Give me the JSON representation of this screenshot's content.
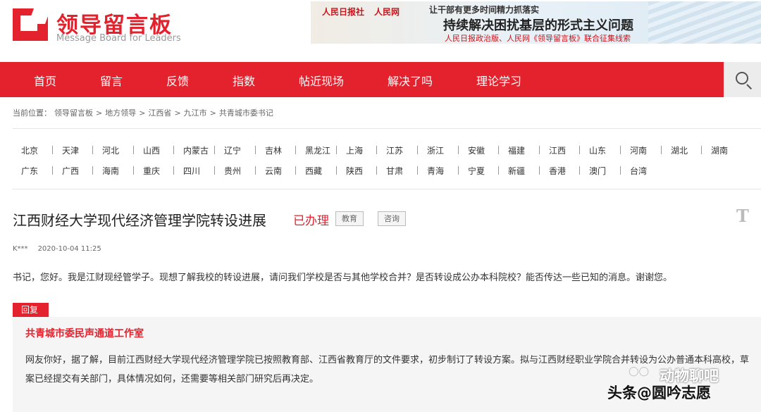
{
  "header": {
    "logo_title": "领导留言板",
    "logo_subtitle": "Message Board for Leaders",
    "banner": {
      "logos": [
        "人民日报社",
        "人民网"
      ],
      "line1": "让干部有更多时间精力抓落实",
      "line2": "持续解决困扰基层的形式主义问题",
      "line3": "人民日报政治版、人民网《领导留言板》联合征集线索"
    }
  },
  "nav": {
    "items": [
      "首页",
      "留言",
      "反馈",
      "指数",
      "帖近现场",
      "解决了吗",
      "理论学习"
    ],
    "search_icon": "search-icon"
  },
  "breadcrumb": {
    "label": "当前位置：",
    "items": [
      "领导留言板",
      ">",
      "地方领导",
      ">",
      "江西省",
      ">",
      "九江市",
      ">",
      "共青城市委书记"
    ]
  },
  "regions": {
    "row1": [
      "北京",
      "天津",
      "河北",
      "山西",
      "内蒙古",
      "辽宁",
      "吉林",
      "黑龙江",
      "上海",
      "江苏",
      "浙江",
      "安徽",
      "福建",
      "江西",
      "山东",
      "河南",
      "湖北",
      "湖南"
    ],
    "row2": [
      "广东",
      "广西",
      "海南",
      "重庆",
      "四川",
      "贵州",
      "云南",
      "西藏",
      "陕西",
      "甘肃",
      "青海",
      "宁夏",
      "新疆",
      "香港",
      "澳门",
      "台湾"
    ]
  },
  "message": {
    "title": "江西财经大学现代经济管理学院转设进展",
    "status": "已办理",
    "tags": [
      "教育",
      "咨询"
    ],
    "font_toggle": "T",
    "author": "K***",
    "datetime": "2020-10-04 11:25",
    "content": "书记，您好。我是江财现经管学子。现想了解我校的转设进展，请问我们学校是否与其他学校合并？是否转设成公办本科院校？能否传达一些已知的消息。谢谢您。"
  },
  "reply": {
    "badge": "回复",
    "org": "共青城市委民声通道工作室",
    "content": "网友你好，据了解，目前江西财经大学现代经济管理学院已按照教育部、江西省教育厅的文件要求，初步制订了转设方案。拟与江西财经职业学院合并转设为公办普通本科高校，草案已经提交有关部门，具体情况如何，还需要等相关部门研究后再决定。"
  },
  "watermark": {
    "top": "动物聊吧",
    "bottom": "头条@圆吟志愿"
  },
  "colors": {
    "brand_red": "#e3222d",
    "reply_bg": "#f5f5f5"
  }
}
